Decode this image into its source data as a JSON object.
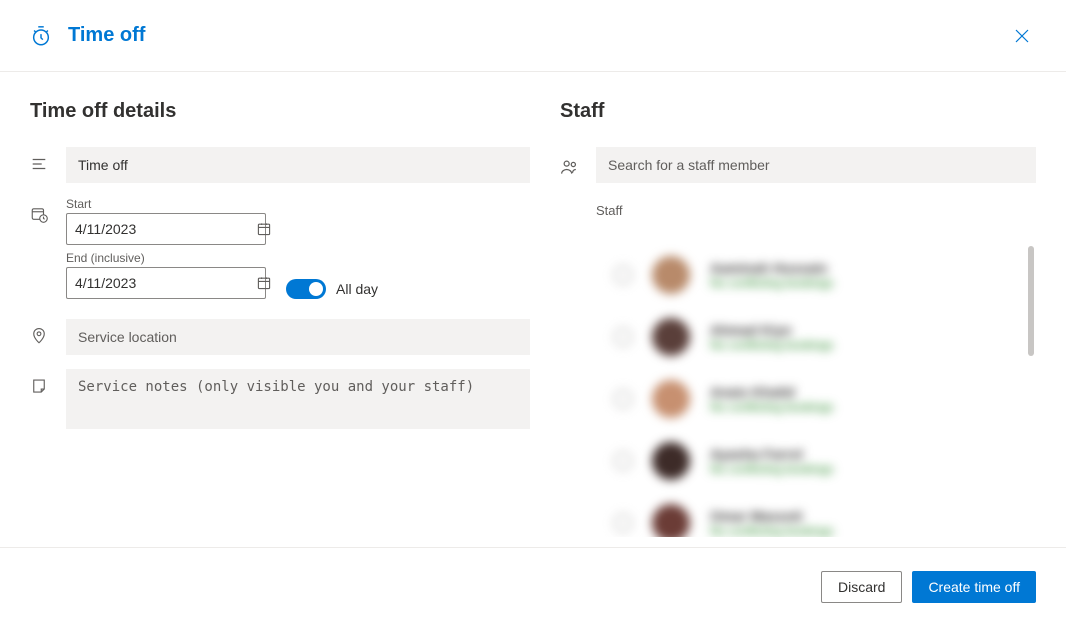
{
  "header": {
    "title": "Time off"
  },
  "details": {
    "section_title": "Time off details",
    "title_value": "Time off",
    "start_label": "Start",
    "start_value": "4/11/2023",
    "end_label": "End (inclusive)",
    "end_value": "4/11/2023",
    "all_day_label": "All day",
    "location_placeholder": "Service location",
    "notes_placeholder": "Service notes (only visible you and your staff)"
  },
  "staff": {
    "section_title": "Staff",
    "search_placeholder": "Search for a staff member",
    "list_label": "Staff",
    "members": [
      {
        "name": "Aaminah Hussain",
        "status": "No conflicting bookings"
      },
      {
        "name": "Ahmad Kiyn",
        "status": "No conflicting bookings"
      },
      {
        "name": "Anais Khalid",
        "status": "No conflicting bookings"
      },
      {
        "name": "Ayasha Farrol",
        "status": "No conflicting bookings"
      },
      {
        "name": "Omar Massoti",
        "status": "No conflicting bookings"
      }
    ]
  },
  "footer": {
    "discard": "Discard",
    "create": "Create time off"
  }
}
